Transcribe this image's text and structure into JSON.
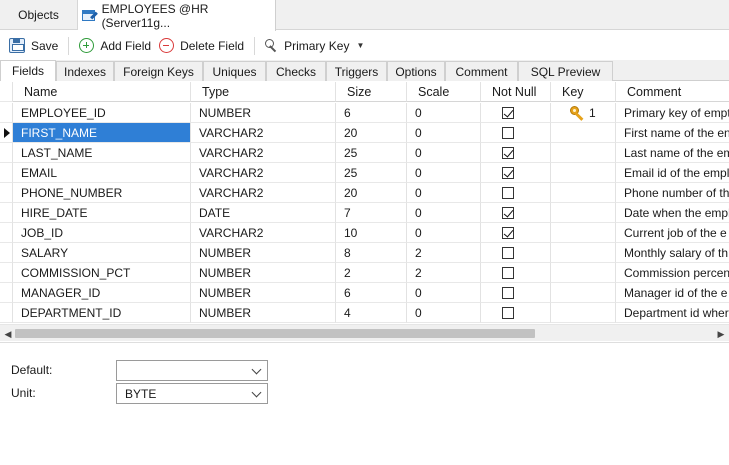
{
  "doc_tabs": [
    {
      "label": "Objects"
    },
    {
      "label": "EMPLOYEES @HR (Server11g..."
    }
  ],
  "toolbar": {
    "save": "Save",
    "add_field": "Add Field",
    "delete_field": "Delete Field",
    "primary_key": "Primary Key"
  },
  "sub_tabs": [
    "Fields",
    "Indexes",
    "Foreign Keys",
    "Uniques",
    "Checks",
    "Triggers",
    "Options",
    "Comment",
    "SQL Preview"
  ],
  "active_sub_tab": "Fields",
  "grid": {
    "headers": [
      "Name",
      "Type",
      "Size",
      "Scale",
      "Not Null",
      "Key",
      "Comment"
    ],
    "rows": [
      {
        "name": "EMPLOYEE_ID",
        "type": "NUMBER",
        "size": "6",
        "scale": "0",
        "not_null": true,
        "key": "1",
        "comment": "Primary key of empt"
      },
      {
        "name": "FIRST_NAME",
        "type": "VARCHAR2",
        "size": "20",
        "scale": "0",
        "not_null": false,
        "key": "",
        "comment": "First name of the en",
        "selected": true
      },
      {
        "name": "LAST_NAME",
        "type": "VARCHAR2",
        "size": "25",
        "scale": "0",
        "not_null": true,
        "key": "",
        "comment": "Last name of the em"
      },
      {
        "name": "EMAIL",
        "type": "VARCHAR2",
        "size": "25",
        "scale": "0",
        "not_null": true,
        "key": "",
        "comment": "Email id of the empl"
      },
      {
        "name": "PHONE_NUMBER",
        "type": "VARCHAR2",
        "size": "20",
        "scale": "0",
        "not_null": false,
        "key": "",
        "comment": "Phone number of th"
      },
      {
        "name": "HIRE_DATE",
        "type": "DATE",
        "size": "7",
        "scale": "0",
        "not_null": true,
        "key": "",
        "comment": "Date when the empl"
      },
      {
        "name": "JOB_ID",
        "type": "VARCHAR2",
        "size": "10",
        "scale": "0",
        "not_null": true,
        "key": "",
        "comment": "Current job of the e"
      },
      {
        "name": "SALARY",
        "type": "NUMBER",
        "size": "8",
        "scale": "2",
        "not_null": false,
        "key": "",
        "comment": "Monthly salary of th"
      },
      {
        "name": "COMMISSION_PCT",
        "type": "NUMBER",
        "size": "2",
        "scale": "2",
        "not_null": false,
        "key": "",
        "comment": "Commission percen"
      },
      {
        "name": "MANAGER_ID",
        "type": "NUMBER",
        "size": "6",
        "scale": "0",
        "not_null": false,
        "key": "",
        "comment": "Manager id of the e"
      },
      {
        "name": "DEPARTMENT_ID",
        "type": "NUMBER",
        "size": "4",
        "scale": "0",
        "not_null": false,
        "key": "",
        "comment": "Department id wher"
      }
    ]
  },
  "properties": {
    "default_label": "Default:",
    "default_value": "",
    "unit_label": "Unit:",
    "unit_value": "BYTE"
  }
}
